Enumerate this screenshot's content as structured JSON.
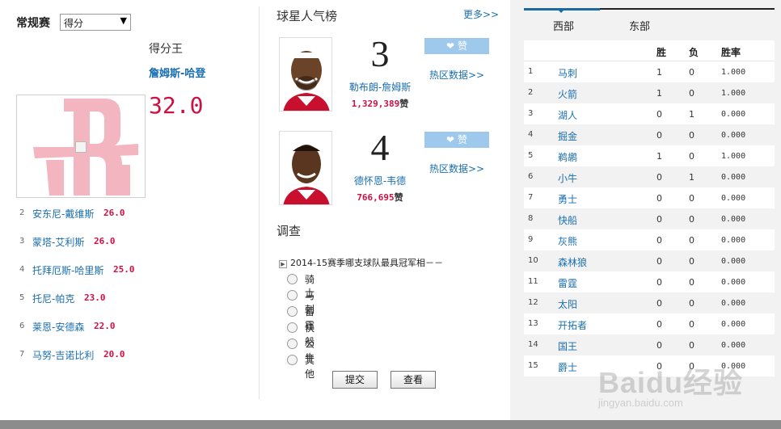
{
  "left": {
    "season_label": "常规赛",
    "stat_select": {
      "selected": "得分",
      "arrow": "▼"
    },
    "leader": {
      "title": "得分王",
      "name": "詹姆斯-哈登",
      "value": "32.0"
    },
    "rankings": [
      {
        "rank": "2",
        "name": "安东尼-戴维斯",
        "value": "26.0"
      },
      {
        "rank": "3",
        "name": "蒙塔-艾利斯",
        "value": "26.0"
      },
      {
        "rank": "4",
        "name": "托拜厄斯-哈里斯",
        "value": "25.0"
      },
      {
        "rank": "5",
        "name": "托尼-帕克",
        "value": "23.0"
      },
      {
        "rank": "6",
        "name": "莱恩-安德森",
        "value": "22.0"
      },
      {
        "rank": "7",
        "name": "马努-吉诺比利",
        "value": "20.0"
      }
    ]
  },
  "popularity": {
    "title": "球星人气榜",
    "more": "更多>>",
    "players": [
      {
        "rank": "3",
        "name": "勒布朗-詹姆斯",
        "likes": "1,329,389",
        "likes_unit": "赞",
        "like_btn": "赞",
        "hot_link": "热区数据>>"
      },
      {
        "rank": "4",
        "name": "德怀恩-韦德",
        "likes": "766,695",
        "likes_unit": "赞",
        "like_btn": "赞",
        "hot_link": "热区数据>>"
      }
    ]
  },
  "survey": {
    "title": "调查",
    "question": "2014-15赛季哪支球队最具冠军相－－",
    "options": [
      "骑士",
      "马刺",
      "雷霆",
      "快船",
      "公牛",
      "其他"
    ],
    "submit": "提交",
    "view": "查看"
  },
  "standings": {
    "tabs": [
      "西部",
      "东部"
    ],
    "active_tab": "西部",
    "headers": {
      "win": "胜",
      "loss": "负",
      "pct": "胜率"
    },
    "rows": [
      {
        "rank": "1",
        "team": "马刺",
        "w": "1",
        "l": "0",
        "pct": "1.000"
      },
      {
        "rank": "2",
        "team": "火箭",
        "w": "1",
        "l": "0",
        "pct": "1.000"
      },
      {
        "rank": "3",
        "team": "湖人",
        "w": "0",
        "l": "1",
        "pct": "0.000"
      },
      {
        "rank": "4",
        "team": "掘金",
        "w": "0",
        "l": "0",
        "pct": "0.000"
      },
      {
        "rank": "5",
        "team": "鹈鹕",
        "w": "1",
        "l": "0",
        "pct": "1.000"
      },
      {
        "rank": "6",
        "team": "小牛",
        "w": "0",
        "l": "1",
        "pct": "0.000"
      },
      {
        "rank": "7",
        "team": "勇士",
        "w": "0",
        "l": "0",
        "pct": "0.000"
      },
      {
        "rank": "8",
        "team": "快船",
        "w": "0",
        "l": "0",
        "pct": "0.000"
      },
      {
        "rank": "9",
        "team": "灰熊",
        "w": "0",
        "l": "0",
        "pct": "0.000"
      },
      {
        "rank": "10",
        "team": "森林狼",
        "w": "0",
        "l": "0",
        "pct": "0.000"
      },
      {
        "rank": "11",
        "team": "雷霆",
        "w": "0",
        "l": "0",
        "pct": "0.000"
      },
      {
        "rank": "12",
        "team": "太阳",
        "w": "0",
        "l": "0",
        "pct": "0.000"
      },
      {
        "rank": "13",
        "team": "开拓者",
        "w": "0",
        "l": "0",
        "pct": "0.000"
      },
      {
        "rank": "14",
        "team": "国王",
        "w": "0",
        "l": "0",
        "pct": "0.000"
      },
      {
        "rank": "15",
        "team": "爵士",
        "w": "0",
        "l": "0",
        "pct": "0.000"
      }
    ]
  },
  "watermark": {
    "brand": "Baidu经验",
    "url": "jingyan.baidu.com"
  },
  "colors": {
    "link": "#1a6fb0",
    "accent": "#cc1144",
    "like_button": "#9ec9ec",
    "tab_active": "#1b6aa0"
  }
}
